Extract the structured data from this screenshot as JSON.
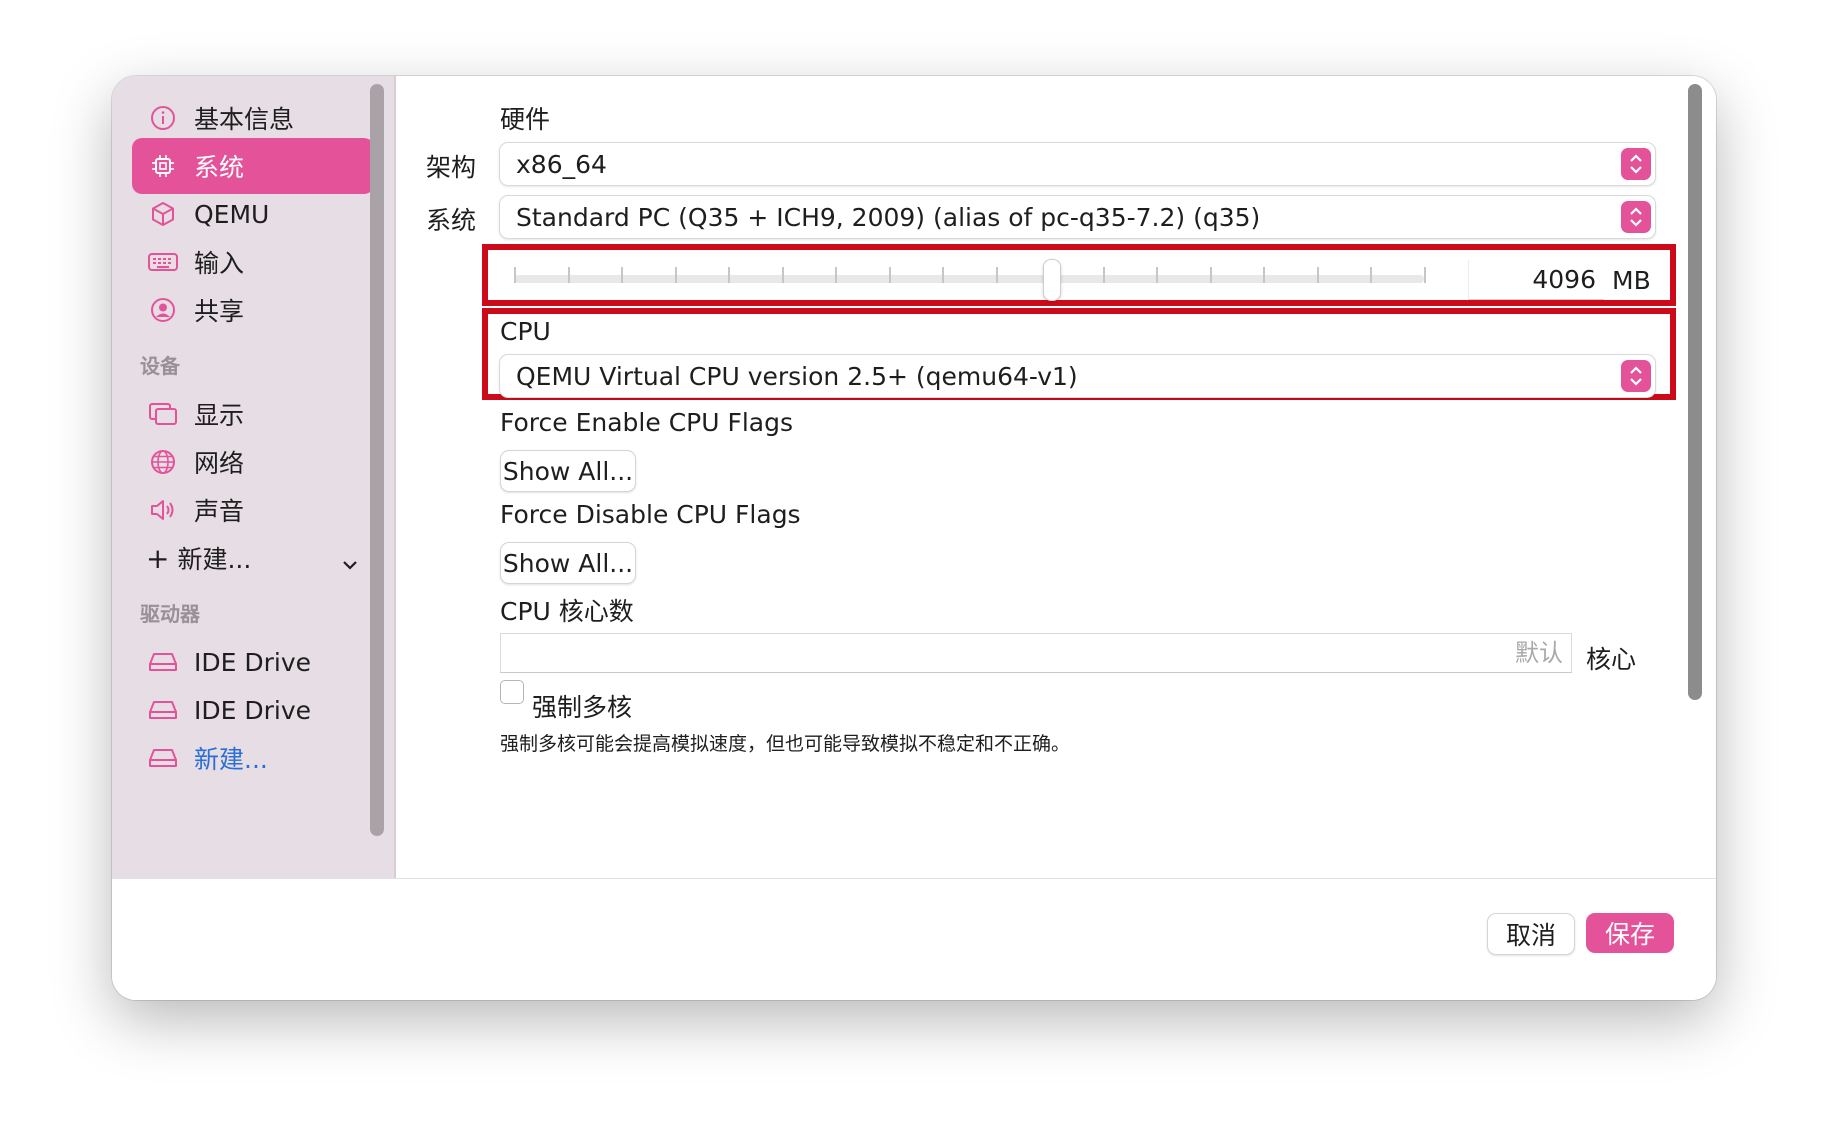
{
  "sidebar": {
    "items": [
      {
        "label": "基本信息",
        "icon": "info-icon"
      },
      {
        "label": "系统",
        "icon": "cpu-chip-icon"
      },
      {
        "label": "QEMU",
        "icon": "cube-icon"
      },
      {
        "label": "输入",
        "icon": "keyboard-icon"
      },
      {
        "label": "共享",
        "icon": "person-circle-icon"
      }
    ],
    "devices_header": "设备",
    "devices": [
      {
        "label": "显示",
        "icon": "display-icon"
      },
      {
        "label": "网络",
        "icon": "globe-icon"
      },
      {
        "label": "声音",
        "icon": "speaker-icon"
      }
    ],
    "new_device_label": "新建...",
    "drives_header": "驱动器",
    "drives": [
      {
        "label": "IDE Drive",
        "icon": "drive-icon"
      },
      {
        "label": "IDE Drive",
        "icon": "drive-icon"
      }
    ],
    "new_drive_label": "新建..."
  },
  "main": {
    "hardware_title": "硬件",
    "arch_label": "架构",
    "arch_value": "x86_64",
    "system_label": "系统",
    "system_value": "Standard PC (Q35 + ICH9, 2009) (alias of pc-q35-7.2) (q35)",
    "memory_value": "4096",
    "memory_unit": "MB",
    "memory_slider_position": 0.59,
    "cpu_title": "CPU",
    "cpu_value": "QEMU Virtual CPU version 2.5+ (qemu64-v1)",
    "force_enable_label": "Force Enable CPU Flags",
    "force_enable_button": "Show All...",
    "force_disable_label": "Force Disable CPU Flags",
    "force_disable_button": "Show All...",
    "cores_label": "CPU 核心数",
    "cores_placeholder": "默认",
    "cores_unit": "核心",
    "force_multicore_label": "强制多核",
    "force_multicore_checked": false,
    "force_multicore_hint": "强制多核可能会提高模拟速度，但也可能导致模拟不稳定和不正确。"
  },
  "footer": {
    "cancel_label": "取消",
    "save_label": "保存"
  },
  "colors": {
    "accent": "#e4539a",
    "highlight_box": "#cc0a1a",
    "sidebar_bg": "#e7dde4"
  }
}
